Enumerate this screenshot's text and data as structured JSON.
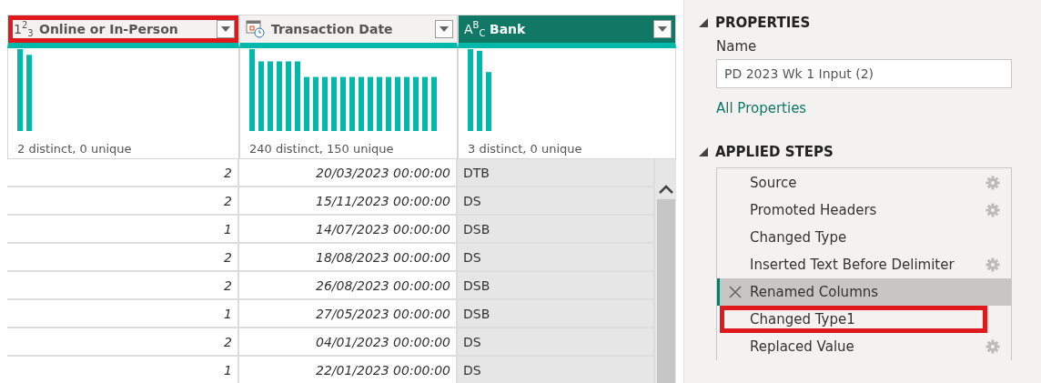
{
  "columns": [
    {
      "kind": "number",
      "type_glyph": "1$^{2}$$_{3}$",
      "title": "Online or In-Person",
      "selected": false,
      "highlighted": true,
      "profile": "2 distinct, 0 unique"
    },
    {
      "kind": "datetime",
      "title": "Transaction Date",
      "selected": false,
      "highlighted": false,
      "profile": "240 distinct, 150 unique"
    },
    {
      "kind": "text",
      "type_glyph": "A$^{B}$$_{C}$",
      "title": "Bank",
      "selected": true,
      "highlighted": false,
      "profile": "3 distinct, 0 unique"
    }
  ],
  "rows": [
    [
      "2",
      "20/03/2023 00:00:00",
      "DTB"
    ],
    [
      "2",
      "15/11/2023 00:00:00",
      "DS"
    ],
    [
      "1",
      "14/07/2023 00:00:00",
      "DSB"
    ],
    [
      "2",
      "18/08/2023 00:00:00",
      "DS"
    ],
    [
      "2",
      "26/08/2023 00:00:00",
      "DSB"
    ],
    [
      "1",
      "27/05/2023 00:00:00",
      "DSB"
    ],
    [
      "2",
      "04/01/2023 00:00:00",
      "DS"
    ],
    [
      "1",
      "22/01/2023 00:00:00",
      "DS"
    ]
  ],
  "properties": {
    "heading": "PROPERTIES",
    "name_label": "Name",
    "name_value": "PD 2023 Wk 1 Input (2)",
    "link": "All Properties"
  },
  "applied_steps": {
    "heading": "APPLIED STEPS",
    "steps": [
      {
        "label": "Source",
        "has_settings": true,
        "selected": false,
        "highlighted": false
      },
      {
        "label": "Promoted Headers",
        "has_settings": true,
        "selected": false,
        "highlighted": false
      },
      {
        "label": "Changed Type",
        "has_settings": false,
        "selected": false,
        "highlighted": false
      },
      {
        "label": "Inserted Text Before Delimiter",
        "has_settings": true,
        "selected": false,
        "highlighted": false
      },
      {
        "label": "Renamed Columns",
        "has_settings": false,
        "selected": true,
        "highlighted": false
      },
      {
        "label": "Changed Type1",
        "has_settings": false,
        "selected": false,
        "highlighted": true
      },
      {
        "label": "Replaced Value",
        "has_settings": true,
        "selected": false,
        "highlighted": false
      }
    ]
  }
}
